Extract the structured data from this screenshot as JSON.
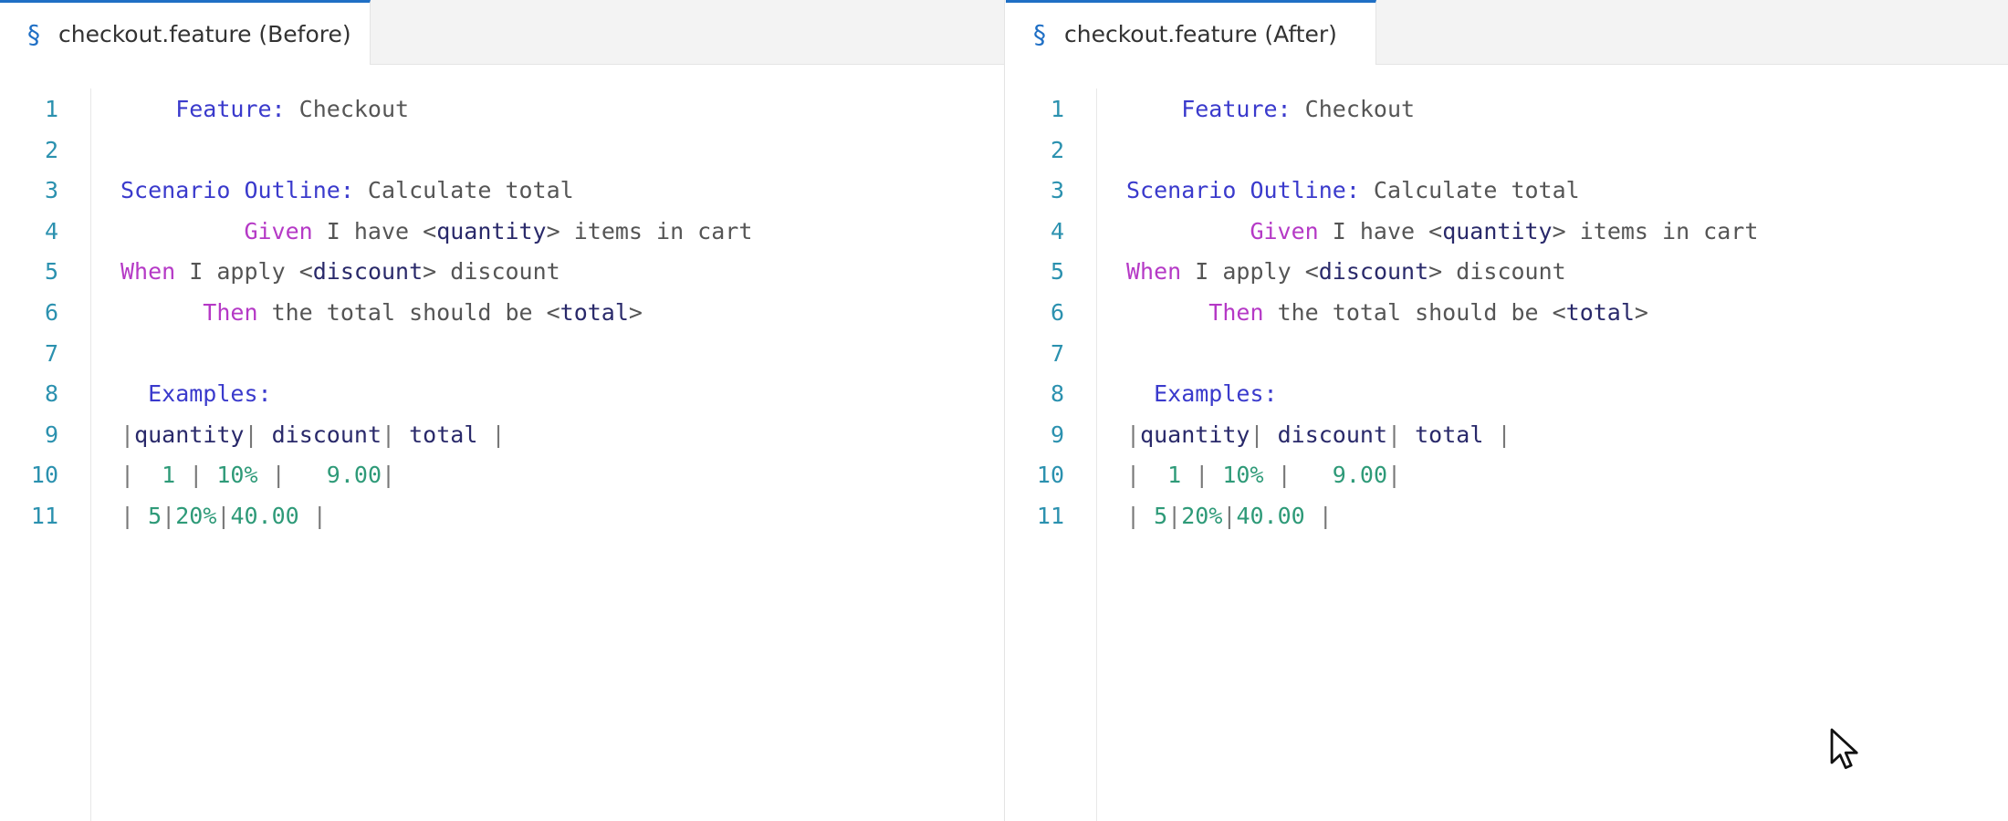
{
  "panes": [
    {
      "tab": {
        "icon": "section-sign-icon",
        "glyph": "§",
        "label": "checkout.feature (Before)"
      },
      "lines": [
        {
          "num": "1",
          "indent": 4,
          "parts": [
            [
              "kw",
              "Feature:"
            ],
            [
              "txt",
              " Checkout"
            ]
          ]
        },
        {
          "num": "2",
          "indent": 0,
          "parts": []
        },
        {
          "num": "3",
          "indent": 0,
          "parts": [
            [
              "kw",
              "Scenario Outline:"
            ],
            [
              "txt",
              " Calculate total"
            ]
          ]
        },
        {
          "num": "4",
          "indent": 9,
          "parts": [
            [
              "step",
              "Given"
            ],
            [
              "txt",
              " I have "
            ],
            [
              "txt",
              "<"
            ],
            [
              "ph",
              "quantity"
            ],
            [
              "txt",
              ">"
            ],
            [
              "txt",
              " items in cart"
            ]
          ]
        },
        {
          "num": "5",
          "indent": 0,
          "parts": [
            [
              "step",
              "When"
            ],
            [
              "txt",
              " I apply "
            ],
            [
              "txt",
              "<"
            ],
            [
              "ph",
              "discount"
            ],
            [
              "txt",
              ">"
            ],
            [
              "txt",
              " discount"
            ]
          ]
        },
        {
          "num": "6",
          "indent": 6,
          "parts": [
            [
              "step",
              "Then"
            ],
            [
              "txt",
              " the total should be "
            ],
            [
              "txt",
              "<"
            ],
            [
              "ph",
              "total"
            ],
            [
              "txt",
              ">"
            ]
          ]
        },
        {
          "num": "7",
          "indent": 0,
          "parts": []
        },
        {
          "num": "8",
          "indent": 2,
          "parts": [
            [
              "kw",
              "Examples:"
            ]
          ]
        },
        {
          "num": "9",
          "indent": 0,
          "parts": [
            [
              "pipe",
              "|"
            ],
            [
              "ph",
              "quantity"
            ],
            [
              "pipe",
              "|"
            ],
            [
              "ph",
              " discount"
            ],
            [
              "pipe",
              "|"
            ],
            [
              "ph",
              " total"
            ],
            [
              "pipe",
              " |"
            ]
          ]
        },
        {
          "num": "10",
          "indent": 0,
          "parts": [
            [
              "pipe",
              "|"
            ],
            [
              "num",
              "  1"
            ],
            [
              "pipe",
              " |"
            ],
            [
              "num",
              " 10%"
            ],
            [
              "pipe",
              " |"
            ],
            [
              "num",
              "   9.00"
            ],
            [
              "pipe",
              "|"
            ]
          ]
        },
        {
          "num": "11",
          "indent": 0,
          "parts": [
            [
              "pipe",
              "|"
            ],
            [
              "num",
              " 5"
            ],
            [
              "pipe",
              "|"
            ],
            [
              "num",
              "20%"
            ],
            [
              "pipe",
              "|"
            ],
            [
              "num",
              "40.00"
            ],
            [
              "pipe",
              " |"
            ]
          ]
        }
      ]
    },
    {
      "tab": {
        "icon": "section-sign-icon",
        "glyph": "§",
        "label": "checkout.feature (After)"
      },
      "lines": [
        {
          "num": "1",
          "indent": 4,
          "parts": [
            [
              "kw",
              "Feature:"
            ],
            [
              "txt",
              " Checkout"
            ]
          ]
        },
        {
          "num": "2",
          "indent": 0,
          "parts": []
        },
        {
          "num": "3",
          "indent": 0,
          "parts": [
            [
              "kw",
              "Scenario Outline:"
            ],
            [
              "txt",
              " Calculate total"
            ]
          ]
        },
        {
          "num": "4",
          "indent": 9,
          "parts": [
            [
              "step",
              "Given"
            ],
            [
              "txt",
              " I have "
            ],
            [
              "txt",
              "<"
            ],
            [
              "ph",
              "quantity"
            ],
            [
              "txt",
              ">"
            ],
            [
              "txt",
              " items in cart"
            ]
          ]
        },
        {
          "num": "5",
          "indent": 0,
          "parts": [
            [
              "step",
              "When"
            ],
            [
              "txt",
              " I apply "
            ],
            [
              "txt",
              "<"
            ],
            [
              "ph",
              "discount"
            ],
            [
              "txt",
              ">"
            ],
            [
              "txt",
              " discount"
            ]
          ]
        },
        {
          "num": "6",
          "indent": 6,
          "parts": [
            [
              "step",
              "Then"
            ],
            [
              "txt",
              " the total should be "
            ],
            [
              "txt",
              "<"
            ],
            [
              "ph",
              "total"
            ],
            [
              "txt",
              ">"
            ]
          ]
        },
        {
          "num": "7",
          "indent": 0,
          "parts": []
        },
        {
          "num": "8",
          "indent": 2,
          "parts": [
            [
              "kw",
              "Examples:"
            ]
          ]
        },
        {
          "num": "9",
          "indent": 0,
          "parts": [
            [
              "pipe",
              "|"
            ],
            [
              "ph",
              "quantity"
            ],
            [
              "pipe",
              "|"
            ],
            [
              "ph",
              " discount"
            ],
            [
              "pipe",
              "|"
            ],
            [
              "ph",
              " total"
            ],
            [
              "pipe",
              " |"
            ]
          ]
        },
        {
          "num": "10",
          "indent": 0,
          "parts": [
            [
              "pipe",
              "|"
            ],
            [
              "num",
              "  1"
            ],
            [
              "pipe",
              " |"
            ],
            [
              "num",
              " 10%"
            ],
            [
              "pipe",
              " |"
            ],
            [
              "num",
              "   9.00"
            ],
            [
              "pipe",
              "|"
            ]
          ]
        },
        {
          "num": "11",
          "indent": 0,
          "parts": [
            [
              "pipe",
              "|"
            ],
            [
              "num",
              " 5"
            ],
            [
              "pipe",
              "|"
            ],
            [
              "num",
              "20%"
            ],
            [
              "pipe",
              "|"
            ],
            [
              "num",
              "40.00"
            ],
            [
              "pipe",
              " |"
            ]
          ]
        }
      ]
    }
  ],
  "colors": {
    "keyword": "#3a3acc",
    "step": "#b539c6",
    "placeholder": "#29296a",
    "number": "#2e9a78",
    "line_number": "#2b91af",
    "tab_accent": "#1f6fc5"
  },
  "cursor": {
    "icon": "mouse-pointer-icon"
  }
}
